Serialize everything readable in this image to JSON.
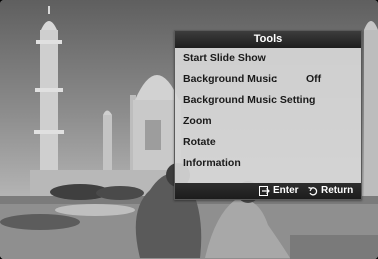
{
  "tools_menu": {
    "title": "Tools",
    "items": [
      {
        "label": "Start Slide Show"
      },
      {
        "label": "Background Music",
        "separator": ":",
        "value": "Off"
      },
      {
        "label": "Background Music Setting"
      },
      {
        "label": "Zoom"
      },
      {
        "label": "Rotate"
      },
      {
        "label": "Information"
      }
    ],
    "footer": {
      "enter_label": "Enter",
      "enter_icon": "enter-icon",
      "return_label": "Return",
      "return_icon": "return-icon"
    }
  },
  "colors": {
    "panel_bg": "#d6d6d6",
    "header_bg": "#1d1d1d",
    "footer_bg": "#1c1c1c",
    "text": "#1a1a1a"
  }
}
